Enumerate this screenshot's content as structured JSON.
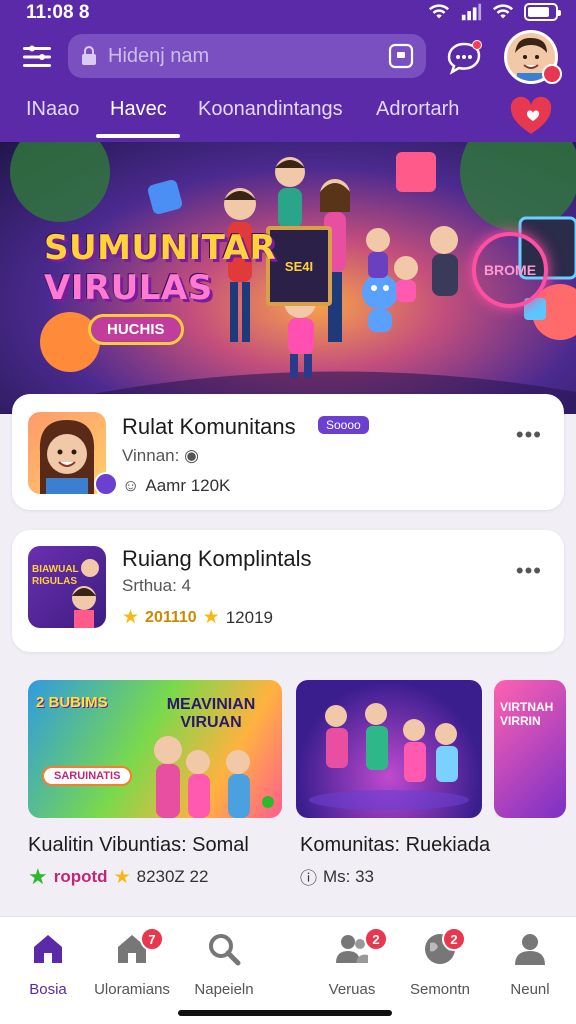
{
  "status": {
    "time": "11:08 8"
  },
  "header": {
    "search_placeholder": "Hidenj nam",
    "icons": [
      "menu-icon",
      "lock-icon",
      "scan-icon",
      "chat-icon",
      "avatar",
      "heart-icon"
    ]
  },
  "tabs": [
    {
      "label": "INaao",
      "active": false
    },
    {
      "label": "Havec",
      "active": true
    },
    {
      "label": "Koonandintangs",
      "active": false
    },
    {
      "label": "Adrortarh",
      "active": false
    }
  ],
  "banner": {
    "title_line1": "SUMUNITAR",
    "title_line2": "VIRULAS",
    "pill": "HUCHIS",
    "board_text": "SE4I",
    "sign_text": "BROME"
  },
  "cards": [
    {
      "title": "Rulat Komunitans",
      "tag": "Soooo",
      "sub": "Vinnan:",
      "meta": "Aamr 120K"
    },
    {
      "title": "Ruiang Komplintals",
      "sub": "Srthua: 4",
      "meta_rating": "201110",
      "meta": "12019",
      "thumb_text": "BIAWUAL RIGULAS"
    }
  ],
  "scroller": {
    "tiles": [
      {
        "text": "MEAVINIAN VIRUAN",
        "sub_text": "2 BUBIMS",
        "pill": "SARUINATIS"
      },
      {
        "text": ""
      },
      {
        "text": "VIRTNAH VIRRIN"
      }
    ],
    "captions": [
      {
        "title": "Kualitin Vibuntias: Somal",
        "rating_text": "ropotd",
        "meta": "8230Z 22"
      },
      {
        "title": "Komunitas: Ruekiada",
        "meta": "Ms: 33"
      }
    ]
  },
  "bottomnav": [
    {
      "label": "Bosia",
      "icon": "home-icon",
      "active": true
    },
    {
      "label": "Uloramians",
      "icon": "house-icon",
      "badge": "7"
    },
    {
      "label": "Napeieln",
      "icon": "search-icon"
    },
    {
      "label": "Veruas",
      "icon": "people-icon",
      "badge": "2"
    },
    {
      "label": "Semontn",
      "icon": "globe-icon",
      "badge": "2"
    },
    {
      "label": "Neunl",
      "icon": "profile-icon"
    }
  ],
  "colors": {
    "primary": "#5a2aa8",
    "accent": "#6b3fd0",
    "badge": "#e8384f",
    "star": "#f5b914"
  }
}
